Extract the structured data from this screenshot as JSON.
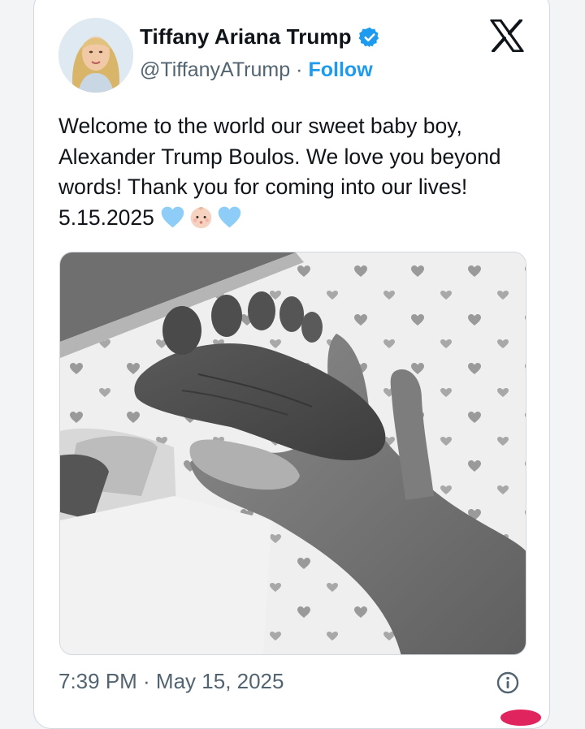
{
  "author": {
    "display_name": "Tiffany Ariana Trump",
    "handle": "@TiffanyATrump",
    "separator": "·",
    "follow_label": "Follow"
  },
  "tweet": {
    "text": "Welcome to the world our sweet baby boy,\nAlexander Trump Boulos. We love you beyond\nwords! Thank you for coming into our lives!\n5.15.2025",
    "emojis": [
      "light-blue-heart",
      "baby",
      "light-blue-heart"
    ],
    "timestamp": "7:39 PM · May 15, 2025"
  },
  "media": {
    "description": "black-and-white photo of an adult hand holding a newborn's foot"
  },
  "colors": {
    "follow": "#1d9bf0",
    "verified": "#1d9bf0",
    "heart": "#8ecdf7",
    "secondary_text": "#536471"
  },
  "icons": [
    "avatar",
    "verified-badge-icon",
    "x-logo-icon",
    "info-icon"
  ]
}
